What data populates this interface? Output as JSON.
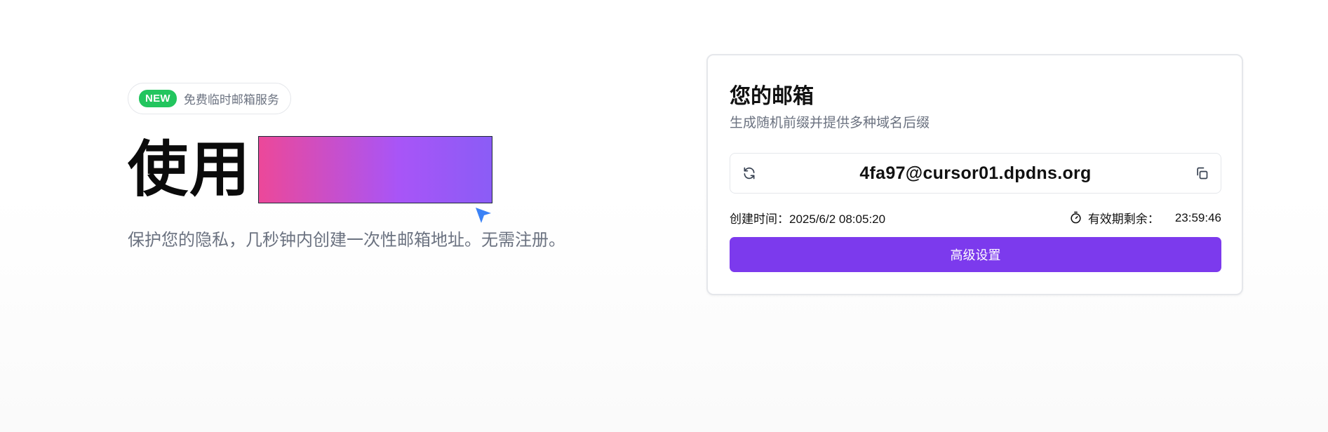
{
  "badge": {
    "new_label": "NEW",
    "text": "免费临时邮箱服务"
  },
  "hero": {
    "headline": "使用",
    "subtitle": "保护您的隐私，几秒钟内创建一次性邮箱地址。无需注册。"
  },
  "card": {
    "title": "您的邮箱",
    "description": "生成随机前缀并提供多种域名后缀",
    "email": "4fa97@cursor01.dpdns.org",
    "created_label": "创建时间：",
    "created_value": "2025/6/2 08:05:20",
    "expiry_label": "有效期剩余：",
    "expiry_value": "23:59:46",
    "advanced_button": "高级设置"
  },
  "colors": {
    "accent": "#7c3aed",
    "badge_green": "#22c55e",
    "gradient_start": "#ec4899",
    "gradient_end": "#8b5cf6"
  },
  "icons": {
    "refresh": "refresh-icon",
    "copy": "copy-icon",
    "timer": "timer-icon",
    "cursor": "mouse-cursor-icon"
  }
}
